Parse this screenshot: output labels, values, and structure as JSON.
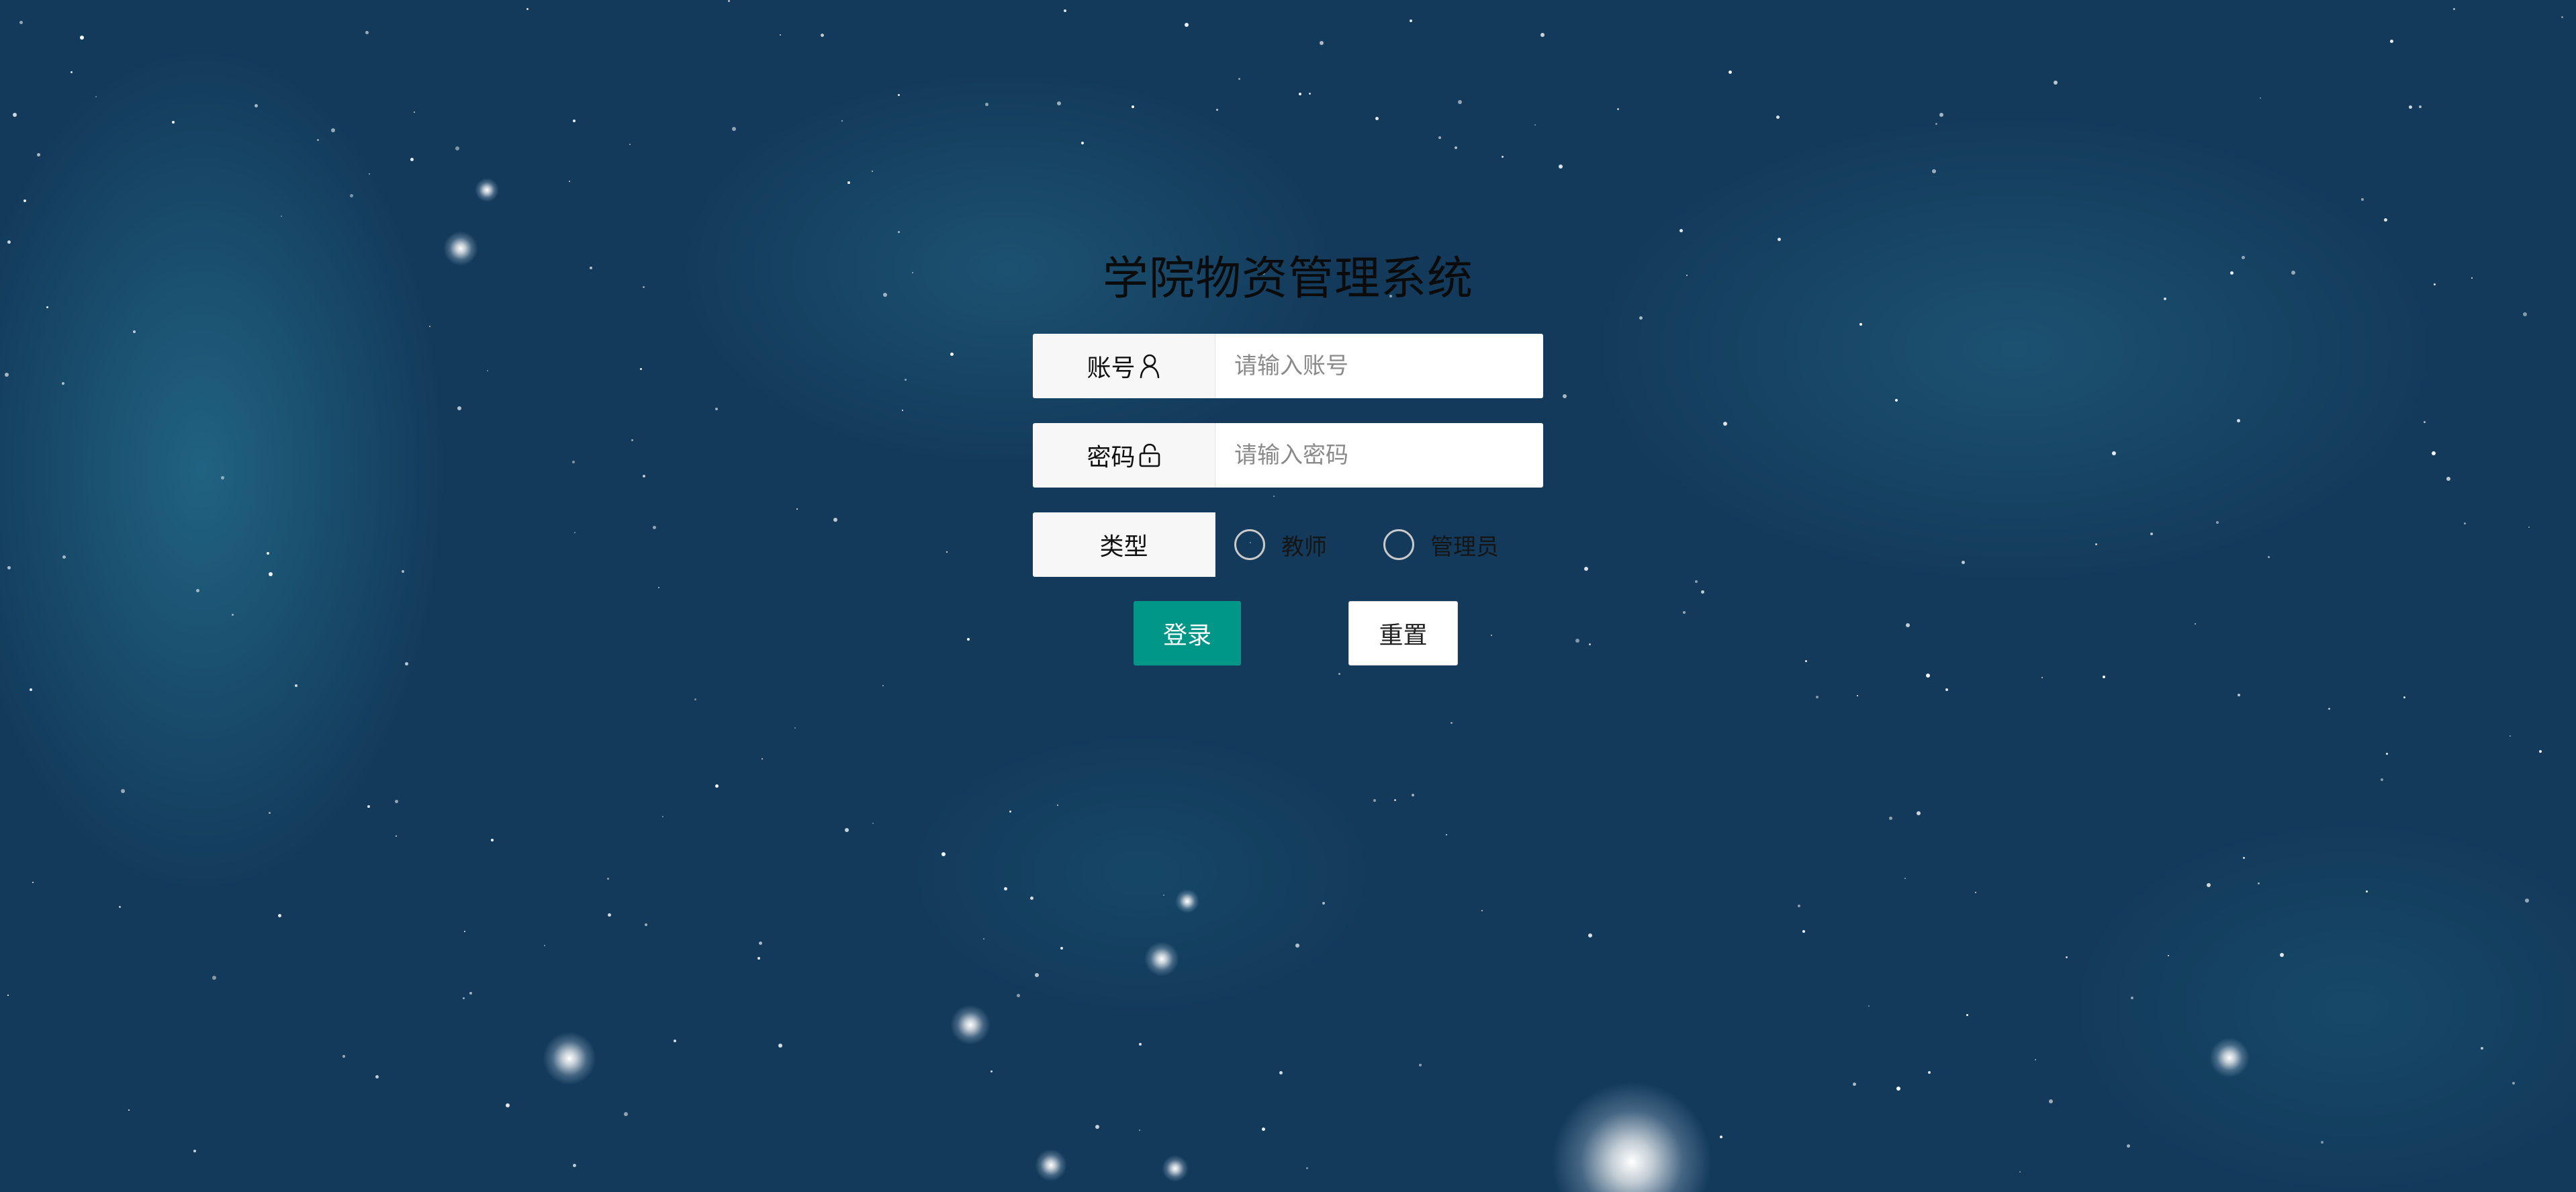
{
  "page": {
    "title": "学院物资管理系统"
  },
  "form": {
    "account": {
      "label": "账号",
      "icon": "user-icon",
      "placeholder": "请输入账号",
      "value": ""
    },
    "password": {
      "label": "密码",
      "icon": "lock-icon",
      "placeholder": "请输入密码",
      "value": ""
    },
    "type": {
      "label": "类型",
      "options": [
        "教师",
        "管理员"
      ],
      "selected": null
    },
    "buttons": {
      "login": "登录",
      "reset": "重置"
    }
  },
  "colors": {
    "background": "#133a5b",
    "primary_button": "#009688",
    "title_text": "#0b0b0b"
  }
}
